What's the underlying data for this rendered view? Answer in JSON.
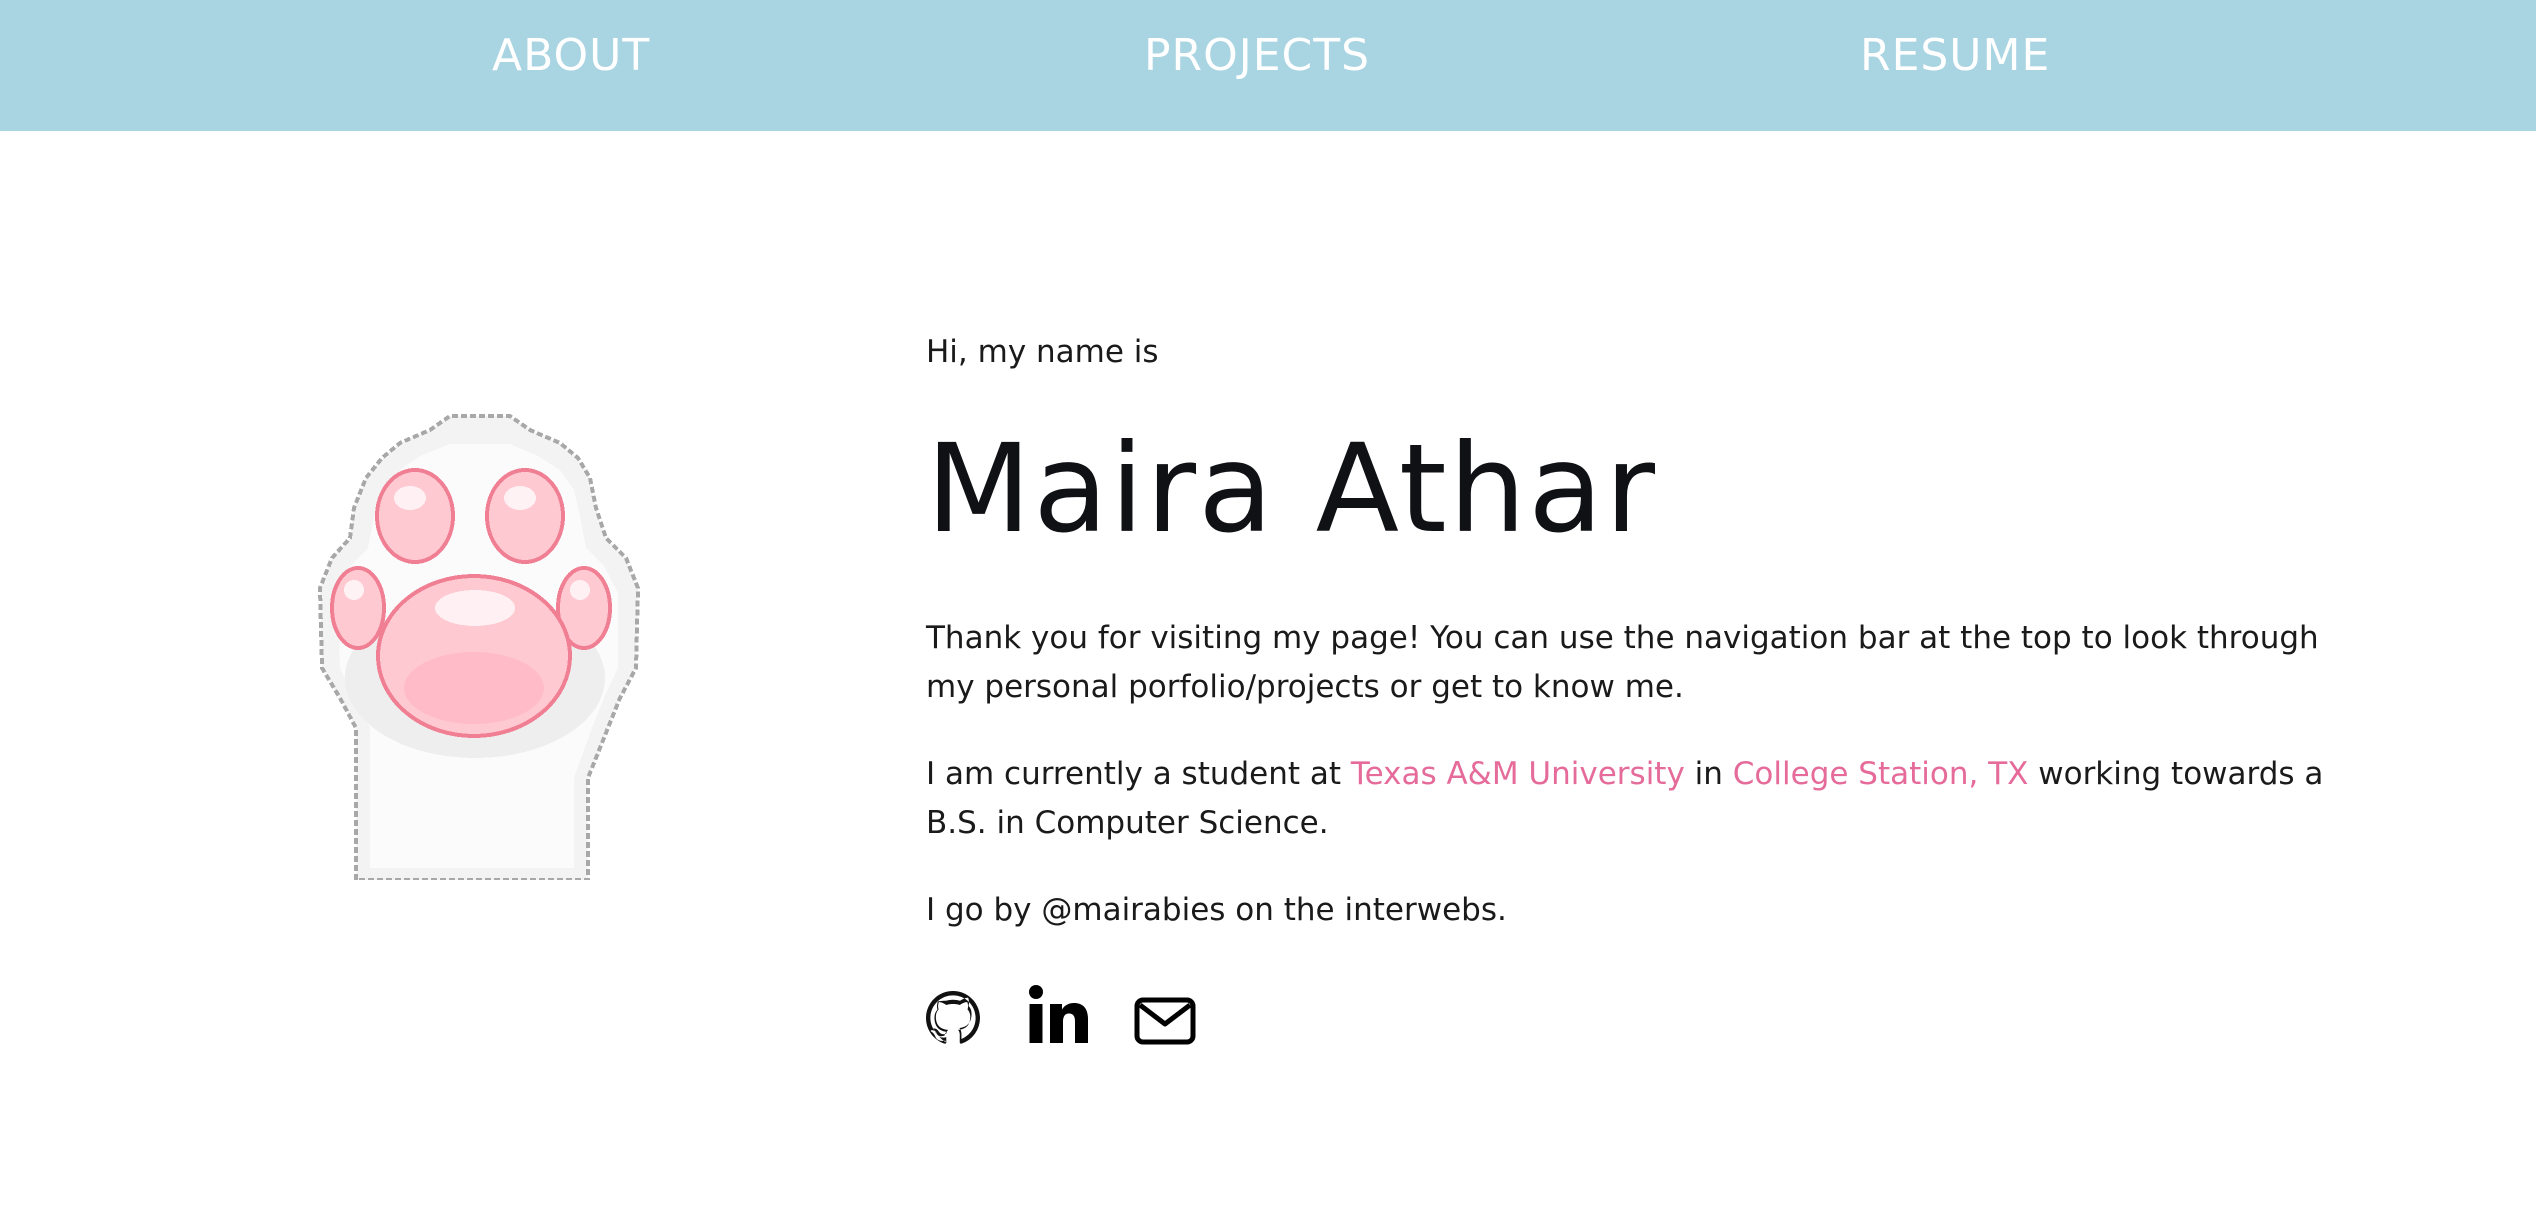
{
  "nav": {
    "about": "ABOUT",
    "projects": "PROJECTS",
    "resume": "RESUME",
    "background_color": "#a9d4e2",
    "text_color": "#ffffff"
  },
  "hero": {
    "image_icon": "cat-paw-pixel-art",
    "intro": "Hi, my name is",
    "name": "Maira Athar",
    "paragraph_thanks": "Thank you for visiting my page! You can use the navigation bar at the top to look through my personal porfolio/projects or get to know me.",
    "paragraph_student": {
      "prefix": "I am currently a student at ",
      "university": "Texas A&M University",
      "middle": " in ",
      "location": "College Station, TX",
      "suffix": " working towards a B.S. in Computer Science."
    },
    "paragraph_handle": "I go by @mairabies on the interwebs.",
    "accent_color": "#e56b9a"
  },
  "socials": [
    {
      "icon": "github-icon"
    },
    {
      "icon": "linkedin-icon"
    },
    {
      "icon": "mail-icon"
    }
  ]
}
